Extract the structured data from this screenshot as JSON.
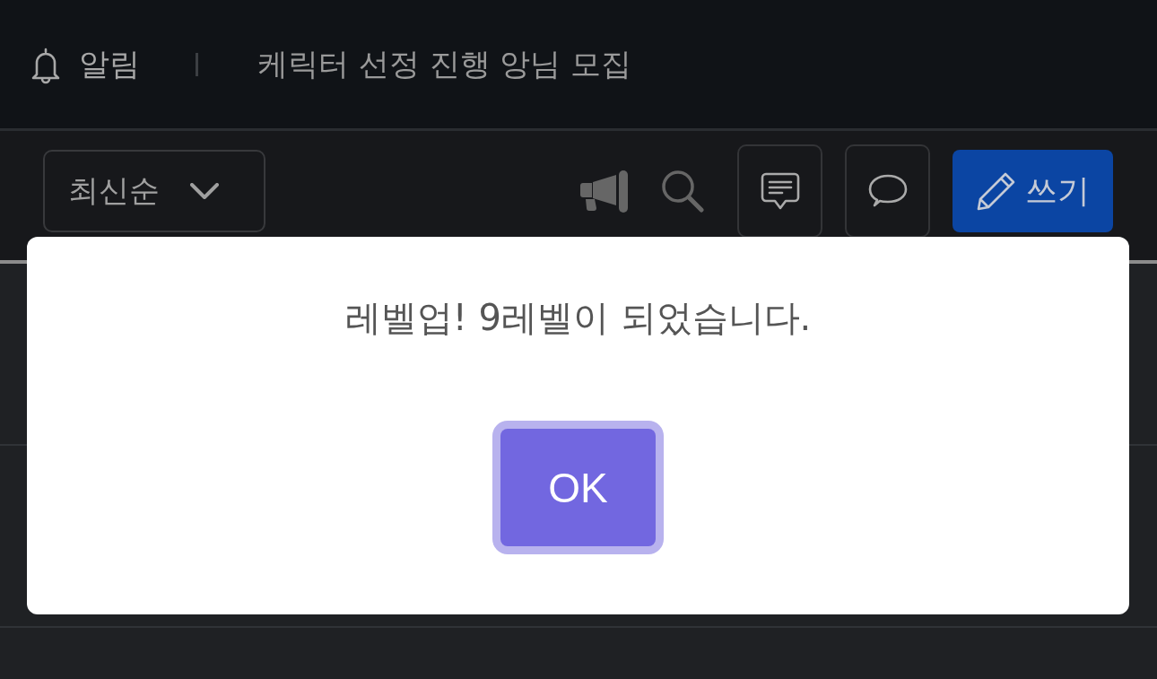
{
  "header": {
    "label": "알림",
    "notice": "케릭터 선정 진행 앙님 모집"
  },
  "toolbar": {
    "sort": {
      "value": "최신순"
    },
    "write_button": "쓰기"
  },
  "dialog": {
    "message": "레벨업! 9레벨이 되었습니다.",
    "button": {
      "label": "OK",
      "focused": true
    }
  }
}
